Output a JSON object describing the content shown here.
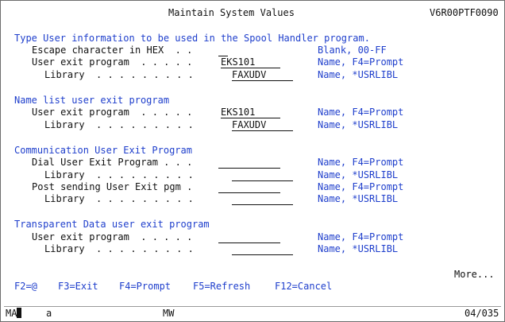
{
  "header": {
    "title": "Maintain System Values",
    "system_id": "V6R00PTF0090"
  },
  "sections": {
    "spool_handler": {
      "heading": "Type User information to be used in the Spool Handler program.",
      "escape_label": "Escape character in HEX  . .",
      "escape_value": "",
      "escape_hint": "Blank, 00-FF",
      "uep_label": "User exit program  . . . . .",
      "uep_value": "EKS101",
      "uep_hint": "Name, F4=Prompt",
      "lib_label": "Library  . . . . . . . . .",
      "lib_value": "FAXUDV",
      "lib_hint": "Name, *USRLIBL"
    },
    "name_list": {
      "heading": "Name list user exit program",
      "uep_label": "User exit program  . . . . .",
      "uep_value": "EKS101",
      "uep_hint": "Name, F4=Prompt",
      "lib_label": "Library  . . . . . . . . .",
      "lib_value": "FAXUDV",
      "lib_hint": "Name, *USRLIBL"
    },
    "communication": {
      "heading": "Communication User Exit Program",
      "dial_label": "Dial User Exit Program . . .",
      "dial_value": "",
      "dial_hint": "Name, F4=Prompt",
      "lib1_label": "Library  . . . . . . . . .",
      "lib1_value": "",
      "lib1_hint": "Name, *USRLIBL",
      "post_label": "Post sending User Exit pgm .",
      "post_value": "",
      "post_hint": "Name, F4=Prompt",
      "lib2_label": "Library  . . . . . . . . .",
      "lib2_value": "",
      "lib2_hint": "Name, *USRLIBL"
    },
    "transparent": {
      "heading": "Transparent Data user exit program",
      "uep_label": "User exit program  . . . . .",
      "uep_value": "",
      "uep_hint": "Name, F4=Prompt",
      "lib_label": "Library  . . . . . . . . .",
      "lib_value": "",
      "lib_hint": "Name, *USRLIBL"
    }
  },
  "more": "More...",
  "function_keys": [
    "F2=@",
    "F3=Exit",
    "F4=Prompt",
    "F5=Refresh",
    "F12=Cancel"
  ],
  "status_bar": {
    "mode": "MA",
    "indicator": "a",
    "session": "MW",
    "position": "04/035"
  }
}
